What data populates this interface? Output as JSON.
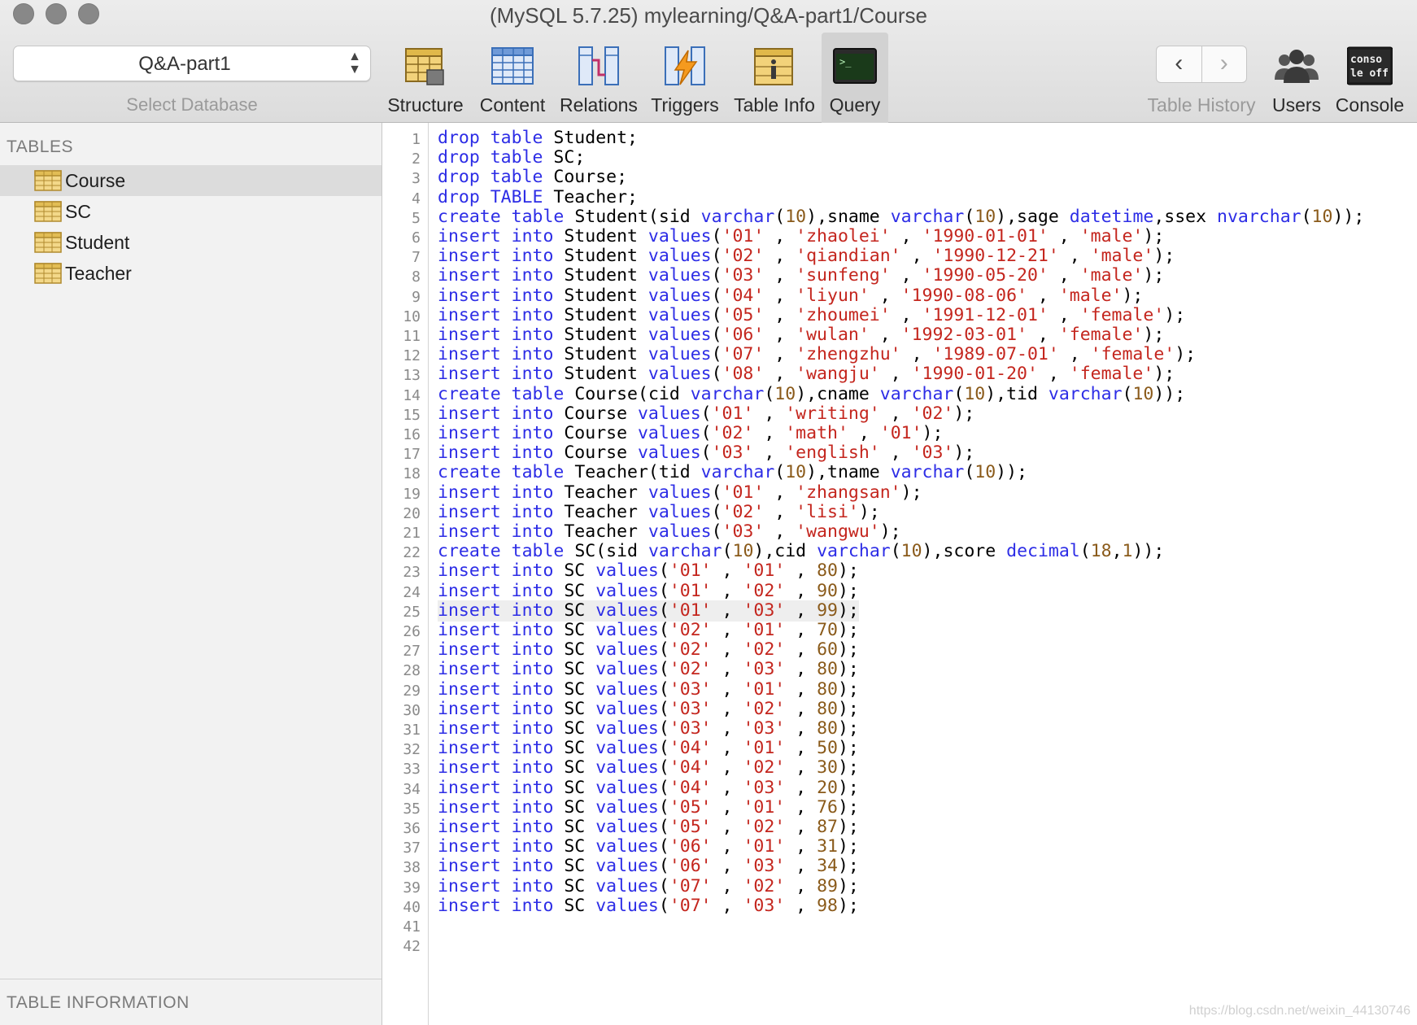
{
  "window": {
    "title": "(MySQL 5.7.25) mylearning/Q&A-part1/Course"
  },
  "toolbar": {
    "database_value": "Q&A-part1",
    "database_caption": "Select Database",
    "items": [
      {
        "label": "Structure"
      },
      {
        "label": "Content"
      },
      {
        "label": "Relations"
      },
      {
        "label": "Triggers"
      },
      {
        "label": "Table Info"
      },
      {
        "label": "Query"
      }
    ],
    "history_label": "Table History",
    "history_back": "‹",
    "history_forward": "›",
    "users_label": "Users",
    "console_label": "Console",
    "console_badge_top": "conso",
    "console_badge_bottom": "le off"
  },
  "sidebar": {
    "header": "TABLES",
    "tables": [
      "Course",
      "SC",
      "Student",
      "Teacher"
    ],
    "selected": "Course",
    "info_header": "TABLE INFORMATION"
  },
  "editor": {
    "highlighted_line": 25,
    "lines": [
      "drop table Student;",
      "drop table SC;",
      "drop table Course;",
      "drop TABLE Teacher;",
      "create table Student(sid varchar(10),sname varchar(10),sage datetime,ssex nvarchar(10));",
      "insert into Student values('01' , 'zhaolei' , '1990-01-01' , 'male');",
      "insert into Student values('02' , 'qiandian' , '1990-12-21' , 'male');",
      "insert into Student values('03' , 'sunfeng' , '1990-05-20' , 'male');",
      "insert into Student values('04' , 'liyun' , '1990-08-06' , 'male');",
      "insert into Student values('05' , 'zhoumei' , '1991-12-01' , 'female');",
      "insert into Student values('06' , 'wulan' , '1992-03-01' , 'female');",
      "insert into Student values('07' , 'zhengzhu' , '1989-07-01' , 'female');",
      "insert into Student values('08' , 'wangju' , '1990-01-20' , 'female');",
      "create table Course(cid varchar(10),cname varchar(10),tid varchar(10));",
      "insert into Course values('01' , 'writing' , '02');",
      "insert into Course values('02' , 'math' , '01');",
      "insert into Course values('03' , 'english' , '03');",
      "create table Teacher(tid varchar(10),tname varchar(10));",
      "insert into Teacher values('01' , 'zhangsan');",
      "insert into Teacher values('02' , 'lisi');",
      "insert into Teacher values('03' , 'wangwu');",
      "create table SC(sid varchar(10),cid varchar(10),score decimal(18,1));",
      "insert into SC values('01' , '01' , 80);",
      "insert into SC values('01' , '02' , 90);",
      "insert into SC values('01' , '03' , 99);",
      "insert into SC values('02' , '01' , 70);",
      "insert into SC values('02' , '02' , 60);",
      "insert into SC values('02' , '03' , 80);",
      "insert into SC values('03' , '01' , 80);",
      "insert into SC values('03' , '02' , 80);",
      "insert into SC values('03' , '03' , 80);",
      "insert into SC values('04' , '01' , 50);",
      "insert into SC values('04' , '02' , 30);",
      "insert into SC values('04' , '03' , 20);",
      "insert into SC values('05' , '01' , 76);",
      "insert into SC values('05' , '02' , 87);",
      "insert into SC values('06' , '01' , 31);",
      "insert into SC values('06' , '03' , 34);",
      "insert into SC values('07' , '02' , 89);",
      "insert into SC values('07' , '03' , 98);",
      "",
      ""
    ]
  },
  "watermark": "https://blog.csdn.net/weixin_44130746",
  "colors": {
    "keyword": "#2d2de6",
    "string": "#c4261e",
    "number": "#8a5a1a",
    "sidebar_bg": "#f2f2f2",
    "selected_row": "#dcdcdc"
  }
}
